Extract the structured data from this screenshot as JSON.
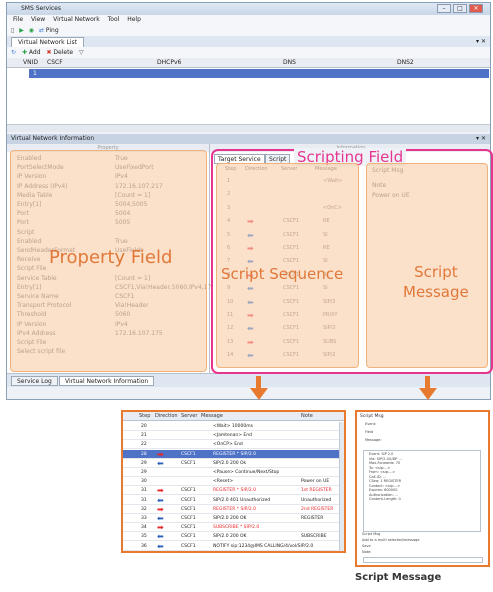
{
  "window": {
    "title": "SMS Services",
    "menu": [
      "File",
      "View",
      "Virtual Network",
      "Tool",
      "Help"
    ],
    "toolbar_ping": "Ping",
    "tab_virtual_network_list": "Virtual Network List",
    "pane_pin": "▾ ✕",
    "toolbar_add": "Add",
    "toolbar_delete": "Delete",
    "grid_columns": [
      "VNID",
      "CSCF",
      "DHCPv6",
      "DNS",
      "DNS2"
    ],
    "grid_row_id": "1",
    "vni_title": "Virtual Network Information",
    "vni_pin": "▾ ✕",
    "property_col": "Property",
    "value_col": "Information",
    "bottom_tabs": [
      "Service Log",
      "Virtual Network Information"
    ]
  },
  "properties": [
    {
      "name": "Enabled",
      "value": "True"
    },
    {
      "name": "PortSelectMode",
      "value": "UseFixedPort"
    },
    {
      "name": "IP Version",
      "value": "IPv4"
    },
    {
      "name": "IP Address (IPv4)",
      "value": "172.16.107.217"
    },
    {
      "name": "Media Table",
      "value": "[Count = 1]"
    },
    {
      "name": "Entry[1]",
      "value": "5004,5005"
    },
    {
      "name": "Port",
      "value": "5004"
    },
    {
      "name": "Port",
      "value": "5005"
    },
    {
      "name": "Script",
      "value": ""
    },
    {
      "name": "Enabled",
      "value": "True"
    },
    {
      "name": "SendHeaderFormat",
      "value": "UseFields"
    },
    {
      "name": "Receive",
      "value": ""
    },
    {
      "name": "Script File",
      "value": ""
    },
    {
      "name": "Service Table",
      "value": "[Count = 1]"
    },
    {
      "name": "Entry[1]",
      "value": "CSCF1,Via!Header,5060,IPv4,17"
    },
    {
      "name": "Service Name",
      "value": "CSCF1"
    },
    {
      "name": "Transport Protocol",
      "value": "Via!Header"
    },
    {
      "name": "Threshold",
      "value": "5060"
    },
    {
      "name": "IP Version",
      "value": "IPv4"
    },
    {
      "name": "IPv4 Address",
      "value": "172.16.107.175"
    },
    {
      "name": "Script File",
      "value": ""
    },
    {
      "name": "Select script file",
      "value": ""
    }
  ],
  "labels": {
    "property_field": "Property Field",
    "scripting_field": "Scripting Field",
    "script_sequence": "Script Sequence",
    "script_message": "Script Message",
    "caption": "Script Message"
  },
  "script_tabs": [
    "Target Service",
    "Script"
  ],
  "sequence_columns": [
    "Step",
    "Direction",
    "Server",
    "Message"
  ],
  "message_panel": {
    "title": "Script Msg",
    "rows": [
      "Note",
      "Power on UE"
    ]
  },
  "sequence_rows": [
    {
      "step": "1",
      "dir": "",
      "server": "",
      "msg": "<Wait>"
    },
    {
      "step": "2",
      "dir": "",
      "server": "",
      "msg": ""
    },
    {
      "step": "3",
      "dir": "",
      "server": "",
      "msg": "<OnC>"
    },
    {
      "step": "4",
      "dir": "right",
      "server": "CSCF1",
      "msg": "RE"
    },
    {
      "step": "5",
      "dir": "left",
      "server": "CSCF1",
      "msg": "SI"
    },
    {
      "step": "6",
      "dir": "right",
      "server": "CSCF1",
      "msg": "RE"
    },
    {
      "step": "7",
      "dir": "left",
      "server": "CSCF1",
      "msg": "SI"
    },
    {
      "step": "8",
      "dir": "right",
      "server": "CSCF1",
      "msg": "RE"
    },
    {
      "step": "9",
      "dir": "left",
      "server": "CSCF1",
      "msg": "SI"
    },
    {
      "step": "10",
      "dir": "left",
      "server": "CSCF1",
      "msg": "SIP/2"
    },
    {
      "step": "11",
      "dir": "right",
      "server": "CSCF1",
      "msg": "PRIXY"
    },
    {
      "step": "12",
      "dir": "left",
      "server": "CSCF1",
      "msg": "SIP/2"
    },
    {
      "step": "13",
      "dir": "right",
      "server": "CSCF1",
      "msg": "SUBS"
    },
    {
      "step": "14",
      "dir": "left",
      "server": "CSCF1",
      "msg": "SIP/2"
    }
  ],
  "zoom_columns": [
    "Step",
    "Direction",
    "Server",
    "Message",
    "Note"
  ],
  "zoom_rows": [
    {
      "step": "20",
      "dir": "",
      "server": "",
      "msg": "<Wait> 10000ms",
      "note": "",
      "style": "plain"
    },
    {
      "step": "21",
      "dir": "",
      "server": "",
      "msg": "<Jamtenan> End",
      "note": "",
      "style": "plain"
    },
    {
      "step": "22",
      "dir": "",
      "server": "",
      "msg": "<OnCP> End",
      "note": "",
      "style": "plain"
    },
    {
      "step": "28",
      "dir": "right",
      "server": "CSCF1",
      "msg": "REGISTER * SIP/2.0",
      "note": "",
      "style": "selected"
    },
    {
      "step": "29",
      "dir": "left",
      "server": "CSCF1",
      "msg": "SIP/2.0 200 Ok",
      "note": "",
      "style": "plain"
    },
    {
      "step": "29",
      "dir": "",
      "server": "",
      "msg": "<Pause> Continue/Next/Stop",
      "note": "",
      "style": "plain"
    },
    {
      "step": "30",
      "dir": "",
      "server": "",
      "msg": "<Reset>",
      "note": "Power on UE",
      "style": "plain"
    },
    {
      "step": "31",
      "dir": "right",
      "server": "CSCF1",
      "msg": "REGISTER * SIP/2.0",
      "note": "1st REGISTER",
      "style": "red"
    },
    {
      "step": "31",
      "dir": "left",
      "server": "CSCF1",
      "msg": "SIP/2.0 401 Unauthorized",
      "note": "Unauthorized",
      "style": "plain"
    },
    {
      "step": "32",
      "dir": "right",
      "server": "CSCF1",
      "msg": "REGISTER * SIP/2.0",
      "note": "2nd REGISTER",
      "style": "red"
    },
    {
      "step": "33",
      "dir": "left",
      "server": "CSCF1",
      "msg": "SIP/2.0 200 OK",
      "note": "REGISTER",
      "style": "plain"
    },
    {
      "step": "34",
      "dir": "right",
      "server": "CSCF1",
      "msg": "SUBSCRIBE * SIP/2.0",
      "note": "",
      "style": "red"
    },
    {
      "step": "35",
      "dir": "left",
      "server": "CSCF1",
      "msg": "SIP/2.0 200 OK",
      "note": "SUBSCRIBE",
      "style": "plain"
    },
    {
      "step": "36",
      "dir": "left",
      "server": "CSCF1",
      "msg": "NOTIFY sip:1234@IMS CALLING/4/vol/SIP/2.0",
      "note": "",
      "style": "plain"
    }
  ],
  "zoom_msg": {
    "title": "Script Msg",
    "lines": [
      "Event:",
      "Field",
      "Message:",
      "Event:  SIP 2.0",
      "Via: SIP/2.0/UDP ...",
      "Max-Forwards: 70",
      "To: <sip:...>",
      "From: <sip:...>",
      "Call-ID: ...",
      "CSeq: 1 REGISTER",
      "Contact: <sip:...>",
      "Expires: 600000",
      "Authorization: ...",
      "Content-Length: 0"
    ],
    "footer": [
      "Script Msg",
      "Add to a multi selected/message",
      "Save",
      "Note:"
    ]
  },
  "colors": {
    "accent_pink": "#e6348f",
    "accent_orange": "#e87a30",
    "field_fill": "#f8c89e",
    "selection_blue": "#4e72c6",
    "arrow_red": "#e8262a",
    "arrow_blue": "#2a5fb8"
  }
}
